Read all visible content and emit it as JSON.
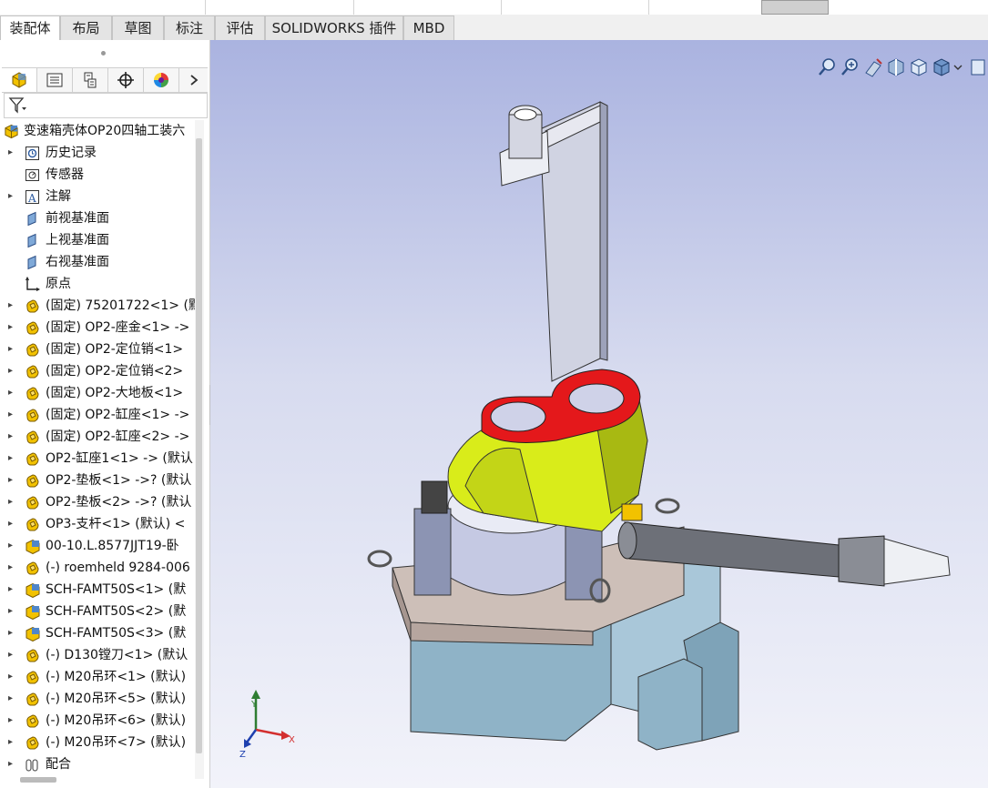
{
  "ribbon_tabs": [
    {
      "label": "装配体",
      "active": true
    },
    {
      "label": "布局"
    },
    {
      "label": "草图"
    },
    {
      "label": "标注"
    },
    {
      "label": "评估"
    },
    {
      "label": "SOLIDWORKS 插件"
    },
    {
      "label": "MBD"
    }
  ],
  "panel_tabs": [
    {
      "icon": "feature-manager-icon"
    },
    {
      "icon": "property-manager-icon"
    },
    {
      "icon": "configuration-manager-icon"
    },
    {
      "icon": "dimxpert-manager-icon"
    },
    {
      "icon": "display-manager-icon"
    }
  ],
  "tree": {
    "root": "变速箱壳体OP20四轴工装六",
    "items": [
      {
        "label": "历史记录",
        "icon": "history-icon",
        "expand": true
      },
      {
        "label": "传感器",
        "icon": "sensor-icon",
        "expand": false
      },
      {
        "label": "注解",
        "icon": "annotation-icon",
        "expand": true
      },
      {
        "label": "前视基准面",
        "icon": "plane-icon",
        "expand": false
      },
      {
        "label": "上视基准面",
        "icon": "plane-icon",
        "expand": false
      },
      {
        "label": "右视基准面",
        "icon": "plane-icon",
        "expand": false
      },
      {
        "label": "原点",
        "icon": "origin-icon",
        "expand": false
      },
      {
        "label": "(固定) 75201722<1> (默",
        "icon": "subassembly-icon",
        "expand": true
      },
      {
        "label": "(固定) OP2-座金<1> ->",
        "icon": "subassembly-icon",
        "expand": true
      },
      {
        "label": "(固定) OP2-定位销<1>",
        "icon": "subassembly-icon",
        "expand": true
      },
      {
        "label": "(固定) OP2-定位销<2>",
        "icon": "subassembly-icon",
        "expand": true
      },
      {
        "label": "(固定) OP2-大地板<1>",
        "icon": "subassembly-icon",
        "expand": true
      },
      {
        "label": "(固定) OP2-缸座<1> ->",
        "icon": "subassembly-icon",
        "expand": true
      },
      {
        "label": "(固定) OP2-缸座<2> ->",
        "icon": "subassembly-icon",
        "expand": true
      },
      {
        "label": "OP2-缸座1<1> -> (默认",
        "icon": "subassembly-icon",
        "expand": true
      },
      {
        "label": "OP2-垫板<1> ->? (默认",
        "icon": "subassembly-icon",
        "expand": true
      },
      {
        "label": "OP2-垫板<2> ->? (默认",
        "icon": "subassembly-icon",
        "expand": true
      },
      {
        "label": "OP3-支杆<1> (默认) <",
        "icon": "subassembly-icon",
        "expand": true
      },
      {
        "label": "00-10.L.8577JJT19-卧",
        "icon": "part-icon",
        "expand": true
      },
      {
        "label": "(-) roemheld 9284-006",
        "icon": "subassembly-icon",
        "expand": true
      },
      {
        "label": "SCH-FAMT50S<1> (默",
        "icon": "part-icon",
        "expand": true
      },
      {
        "label": "SCH-FAMT50S<2> (默",
        "icon": "part-icon",
        "expand": true
      },
      {
        "label": "SCH-FAMT50S<3> (默",
        "icon": "part-icon",
        "expand": true
      },
      {
        "label": "(-) D130镗刀<1> (默认",
        "icon": "subassembly-icon",
        "expand": true
      },
      {
        "label": "(-) M20吊环<1> (默认)",
        "icon": "subassembly-icon",
        "expand": true
      },
      {
        "label": "(-) M20吊环<5> (默认)",
        "icon": "subassembly-icon",
        "expand": true
      },
      {
        "label": "(-) M20吊环<6> (默认)",
        "icon": "subassembly-icon",
        "expand": true
      },
      {
        "label": "(-) M20吊环<7> (默认)",
        "icon": "subassembly-icon",
        "expand": true
      },
      {
        "label": "配合",
        "icon": "mates-icon",
        "expand": true
      }
    ]
  },
  "view_tools": [
    {
      "icon": "zoom-to-fit-icon"
    },
    {
      "icon": "zoom-to-area-icon"
    },
    {
      "icon": "previous-view-icon"
    },
    {
      "icon": "section-view-icon"
    },
    {
      "icon": "view-orientation-icon"
    },
    {
      "icon": "display-style-icon"
    }
  ],
  "triad": {
    "x": "X",
    "y": "Y",
    "z": "Z"
  },
  "colors": {
    "viewport_top": "#aab3e0",
    "viewport_bottom": "#f2f3fa",
    "housing_yellow": "#d9ec1a",
    "flange_red": "#e4181b",
    "base_blue": "#8fb3c7"
  }
}
